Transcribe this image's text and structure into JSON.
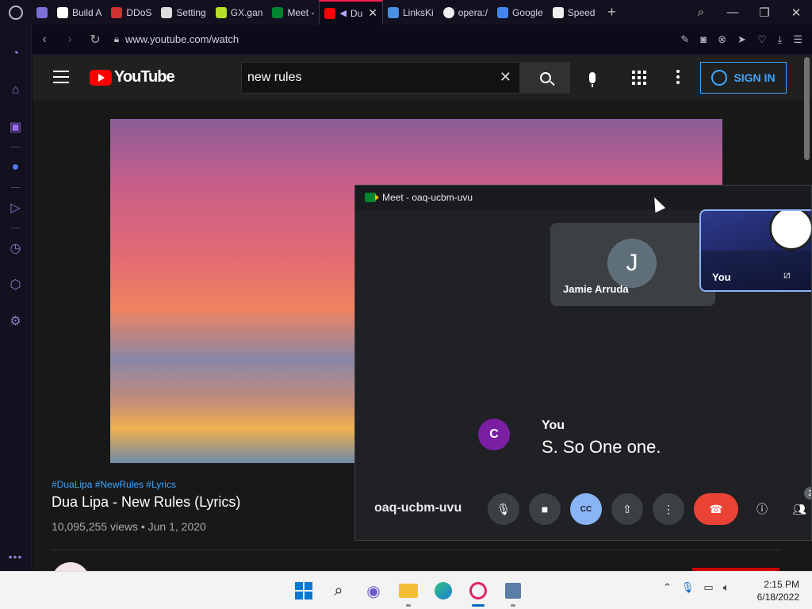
{
  "browser": {
    "tabs": [
      {
        "label": "",
        "color": "#7a6fd6"
      },
      {
        "label": "Build A",
        "color": "#ffffff"
      },
      {
        "label": "DDoS",
        "color": "#d03030"
      },
      {
        "label": "Setting",
        "color": "#dddddd"
      },
      {
        "label": "GX.gan",
        "color": "#b6e02a"
      },
      {
        "label": "Meet -",
        "color": "#00832d"
      },
      {
        "label": "Du",
        "color": "#ff0000"
      },
      {
        "label": "LinksKi",
        "color": "#4a90e2"
      },
      {
        "label": "opera:/",
        "color": "#eeeeee"
      },
      {
        "label": "Google",
        "color": "#4285f4"
      },
      {
        "label": "Speed",
        "color": "#eeeeee"
      }
    ],
    "url": "www.youtube.com/watch"
  },
  "youtube": {
    "logo_text": "YouTube",
    "search_value": "new rules",
    "signin_label": "SIGN IN",
    "hashtags": "#DuaLipa #NewRules #Lyrics",
    "video_title": "Dua Lipa - New Rules (Lyrics)",
    "video_meta": "10,095,255 views • Jun 1, 2020"
  },
  "meet": {
    "window_title": "Meet - oaq-ucbm-uvu",
    "participant_name": "Jamie Arruda",
    "participant_initial": "J",
    "self_label": "You",
    "caption_initial": "C",
    "caption_speaker": "You",
    "caption_text": "S. So One one.",
    "meeting_code": "oaq-ucbm-uvu",
    "participant_count": "2",
    "cc_label": "CC"
  },
  "taskbar": {
    "time": "2:15 PM",
    "date": "6/18/2022"
  }
}
